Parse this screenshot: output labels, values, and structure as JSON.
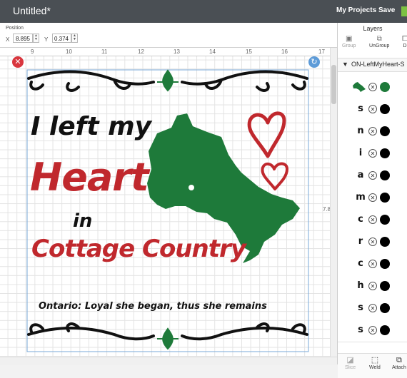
{
  "topbar": {
    "title": "Untitled*",
    "my_projects": "My Projects",
    "save": "Save"
  },
  "toolbar": {
    "position_label": "Position",
    "x_label": "X",
    "x_value": "8.895",
    "y_label": "Y",
    "y_value": "0.374"
  },
  "ruler": {
    "ticks": [
      "9",
      "10",
      "11",
      "12",
      "13",
      "14",
      "15",
      "16",
      "17"
    ],
    "side_mark": "7.8"
  },
  "design": {
    "line1": "I left my",
    "line2": "Heart",
    "line3": "in",
    "line4": "Cottage Country",
    "tagline": "Ontario: Loyal she began, thus she remains"
  },
  "colors": {
    "red": "#c0282d",
    "green": "#1e7a3a",
    "black": "#111111",
    "topbar": "#4a4f54",
    "save_green": "#7dc142"
  },
  "layers_panel": {
    "title": "Layers",
    "group": "Group",
    "ungroup": "UnGroup",
    "duplicate": "D",
    "group_name": "ON-LeftMyHeart-S",
    "layers": [
      {
        "thumb": "",
        "thumb_icon": "ontario-map-icon",
        "dot_color": "#1e7a3a"
      },
      {
        "thumb": "s"
      },
      {
        "thumb": "n"
      },
      {
        "thumb": "i"
      },
      {
        "thumb": "a"
      },
      {
        "thumb": "m"
      },
      {
        "thumb": "c"
      },
      {
        "thumb": "r"
      },
      {
        "thumb": "c"
      },
      {
        "thumb": "h"
      },
      {
        "thumb": "s"
      },
      {
        "thumb": "s"
      }
    ],
    "slice": "Slice",
    "weld": "Weld",
    "attach": "Attach"
  }
}
